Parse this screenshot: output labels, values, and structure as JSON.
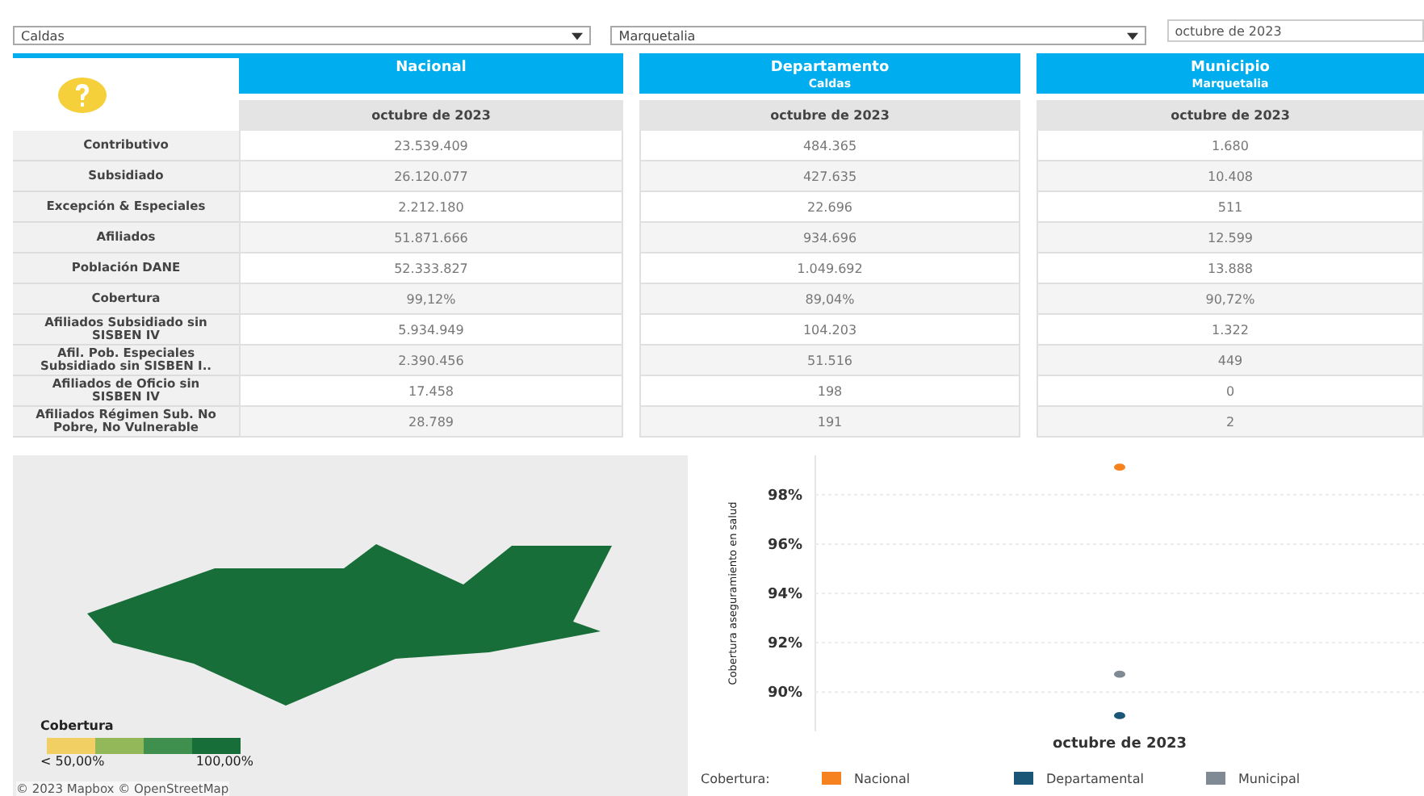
{
  "filters": [
    {
      "kind": "dropdown",
      "value": "Caldas"
    },
    {
      "kind": "dropdown",
      "value": "Marquetalia"
    },
    {
      "kind": "field",
      "value": "octubre de 2023"
    }
  ],
  "panels": [
    {
      "title": "Nacional",
      "date": "octubre de 2023",
      "row_labels": [
        "Contributivo",
        "Subsidiado",
        "Excepción & Especiales",
        "Afiliados",
        "Población DANE",
        "Cobertura",
        "Afiliados Subsidiado sin SISBEN IV",
        "Afil. Pob. Especiales Subsidiado sin SISBEN I..",
        "Afiliados de Oficio sin SISBEN IV",
        "Afiliados Régimen Sub. No Pobre, No Vulnerable"
      ],
      "values": [
        "23.539.409",
        "26.120.077",
        "2.212.180",
        "51.871.666",
        "52.333.827",
        "99,12%",
        "5.934.949",
        "2.390.456",
        "17.458",
        "28.789"
      ]
    },
    {
      "title": "Departamento",
      "subtitle": "Caldas",
      "date": "octubre de 2023",
      "values": [
        "484.365",
        "427.635",
        "22.696",
        "934.696",
        "1.049.692",
        "89,04%",
        "104.203",
        "51.516",
        "198",
        "191"
      ]
    },
    {
      "title": "Municipio",
      "subtitle": "Marquetalia",
      "date": "octubre de 2023",
      "values": [
        "1.680",
        "10.408",
        "511",
        "12.599",
        "13.888",
        "90,72%",
        "1.322",
        "449",
        "0",
        "2"
      ]
    }
  ],
  "map": {
    "legend": {
      "title": "Cobertura",
      "scale": [
        {
          "color": "#f2cf63"
        },
        {
          "color": "#93b85a"
        },
        {
          "color": "#3f8f4f"
        },
        {
          "color": "#176e38"
        }
      ],
      "min_label": "< 50,00%",
      "max_label": "100,00%"
    },
    "attribution": "© 2023 Mapbox © OpenStreetMap"
  },
  "chart": {
    "legend_title": "Cobertura:",
    "chart_data": {
      "type": "scatter",
      "grid": true,
      "ylabel": "Cobertura aseguramiento en salud",
      "categories": [
        "octubre de 2023"
      ],
      "series": [
        {
          "name": "Nacional",
          "color": "#f5821f",
          "values": [
            99.12
          ]
        },
        {
          "name": "Departamental",
          "color": "#1b5677",
          "values": [
            89.04
          ]
        },
        {
          "name": "Municipal",
          "color": "#7f8a94",
          "values": [
            90.72
          ]
        }
      ],
      "ylim": [
        88.4,
        99.6
      ],
      "yticks": [
        {
          "value": 90,
          "label": "90%"
        },
        {
          "value": 92,
          "label": "92%"
        },
        {
          "value": 94,
          "label": "94%"
        },
        {
          "value": 96,
          "label": "96%"
        },
        {
          "value": 98,
          "label": "98%"
        }
      ]
    }
  }
}
